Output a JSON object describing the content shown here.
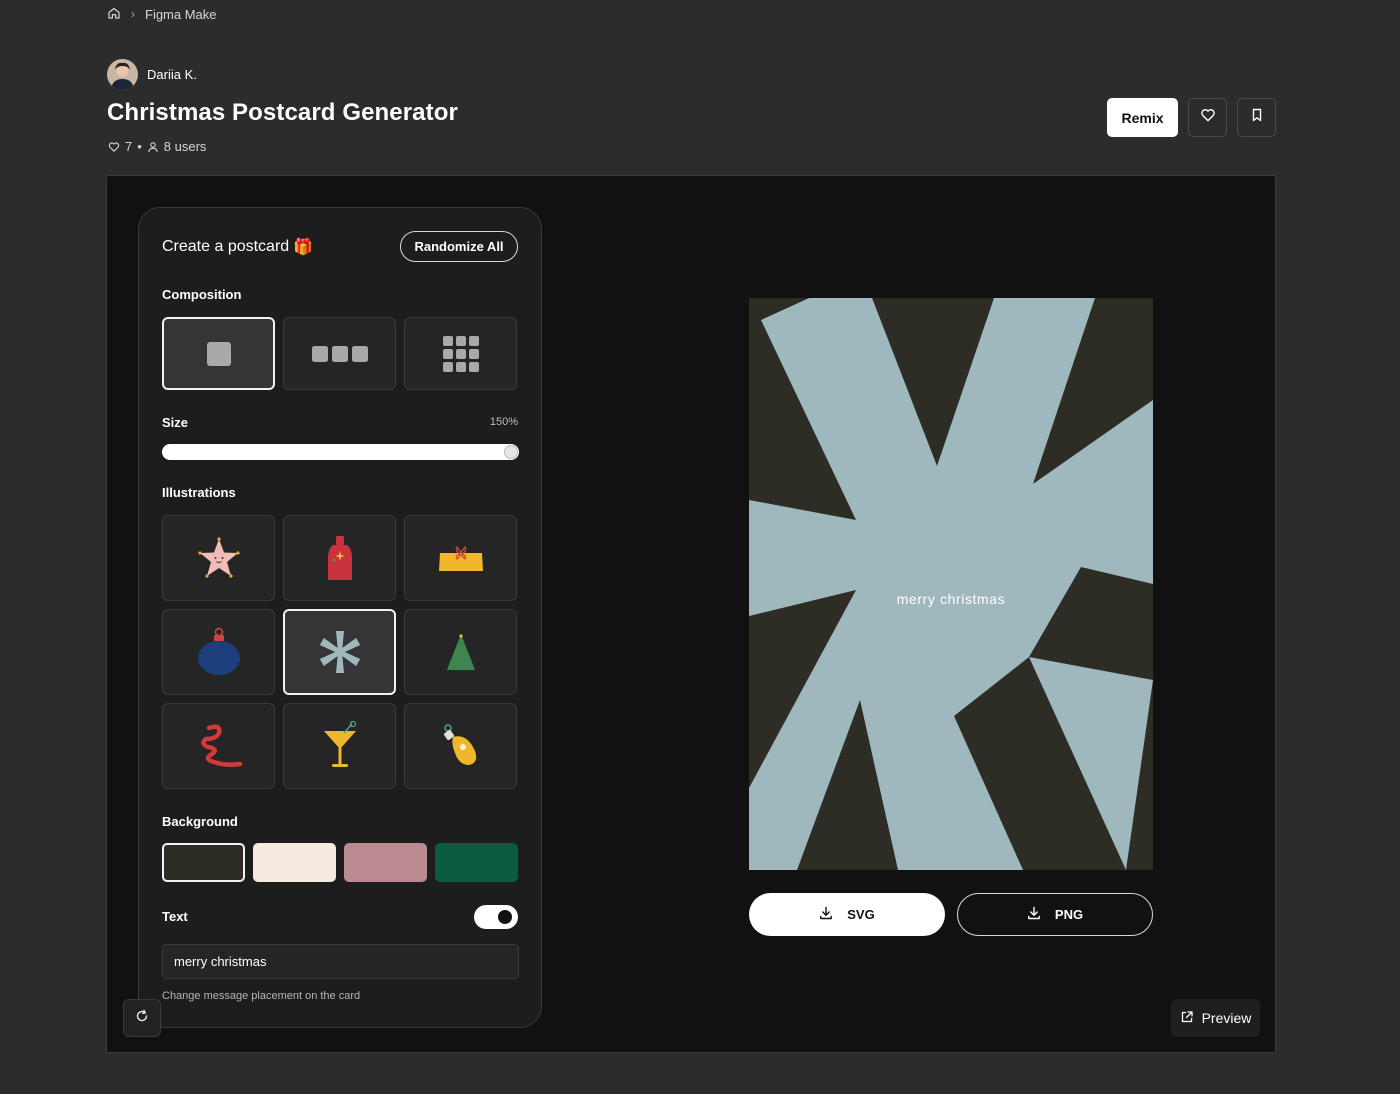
{
  "breadcrumb": {
    "home_icon": "home-icon",
    "current": "Figma Make"
  },
  "author": {
    "name": "Dariia K."
  },
  "page": {
    "title": "Christmas Postcard Generator",
    "likes": "7",
    "users": "8 users"
  },
  "actions": {
    "remix_label": "Remix",
    "like_icon": "heart-icon",
    "save_icon": "bookmark-icon"
  },
  "panel": {
    "title": "Create a postcard",
    "title_emoji": "🎁",
    "randomize_label": "Randomize All",
    "composition": {
      "label": "Composition",
      "options": [
        "single",
        "row-of-three",
        "grid-of-nine"
      ],
      "selected": "single"
    },
    "size": {
      "label": "Size",
      "value": "150%",
      "fraction": 1.0
    },
    "illustrations": {
      "label": "Illustrations",
      "items": [
        "star",
        "bottle",
        "gift-box",
        "ornament",
        "snowflake",
        "tree",
        "ribbon",
        "cocktail",
        "light-bulb"
      ],
      "selected": "snowflake"
    },
    "background": {
      "label": "Background",
      "colors": [
        "#2d2d26",
        "#f5ebe1",
        "#bb8b91",
        "#0b5b41"
      ],
      "selected": "#2d2d26"
    },
    "text": {
      "label": "Text",
      "enabled": true,
      "value": "merry christmas",
      "hint": "Change message placement on the card"
    }
  },
  "preview": {
    "background": "#2d2d26",
    "illustration_color": "#9fb8bd",
    "message": "merry christmas",
    "svg_label": "SVG",
    "png_label": "PNG",
    "preview_label": "Preview"
  }
}
